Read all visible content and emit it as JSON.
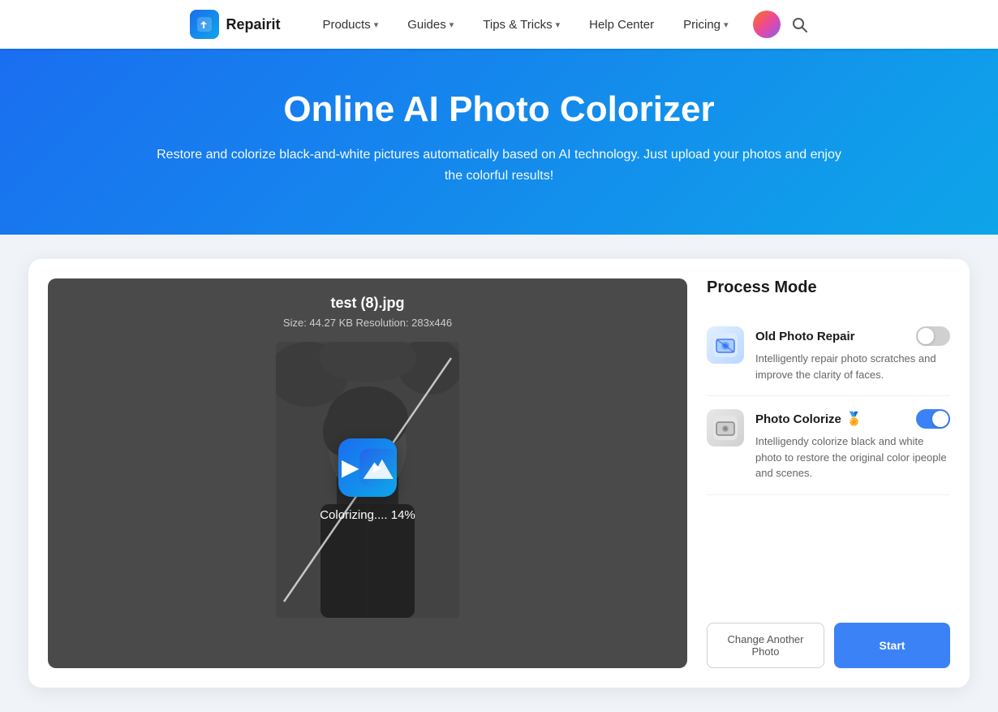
{
  "navbar": {
    "logo_text": "Repairit",
    "items": [
      {
        "label": "Products",
        "has_chevron": true
      },
      {
        "label": "Guides",
        "has_chevron": true
      },
      {
        "label": "Tips & Tricks",
        "has_chevron": true
      },
      {
        "label": "Help Center",
        "has_chevron": false
      },
      {
        "label": "Pricing",
        "has_chevron": true
      }
    ]
  },
  "hero": {
    "title": "Online AI Photo Colorizer",
    "subtitle": "Restore and colorize black-and-white pictures automatically based on AI technology. Just upload your photos and enjoy the colorful results!"
  },
  "file_info": {
    "name": "test (8).jpg",
    "meta": "Size: 44.27 KB  Resolution: 283x446"
  },
  "progress": {
    "text": "Colorizing.... 14%"
  },
  "process_mode": {
    "title": "Process Mode",
    "modes": [
      {
        "name": "Old Photo Repair",
        "desc": "Intelligently repair photo scratches and improve the clarity of faces.",
        "toggle": "off",
        "has_premium": false
      },
      {
        "name": "Photo Colorize",
        "desc": "Intelligendy colorize black and white photo to restore the original color ipeople and scenes.",
        "toggle": "on",
        "has_premium": true,
        "premium_icon": "🏅"
      }
    ]
  },
  "buttons": {
    "change_photo": "Change Another Photo",
    "start": "Start"
  }
}
